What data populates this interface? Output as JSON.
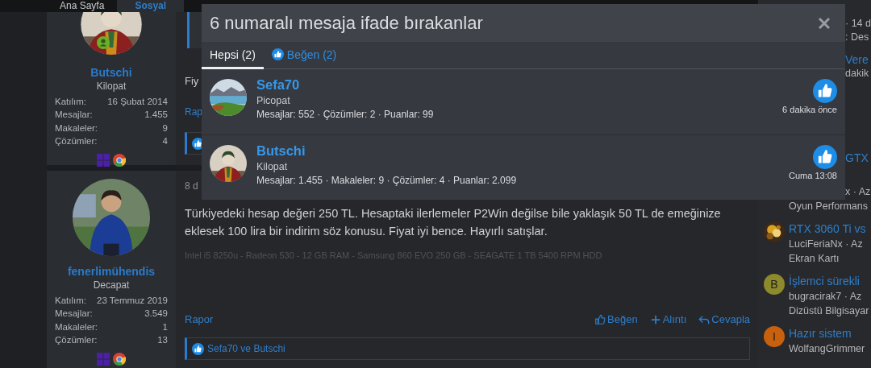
{
  "nav": {
    "items": [
      {
        "label": "Ana Sayfa",
        "selected": false
      },
      {
        "label": "Sosyal",
        "selected": true
      }
    ]
  },
  "posts": [
    {
      "author": {
        "name": "Butschi",
        "title": "Kilopat",
        "online": true,
        "stats": [
          {
            "label": "Katılım:",
            "value": "16 Şubat 2014"
          },
          {
            "label": "Mesajlar:",
            "value": "1.455"
          },
          {
            "label": "Makaleler:",
            "value": "9"
          },
          {
            "label": "Çözümler:",
            "value": "4"
          }
        ]
      },
      "quote": true,
      "body": "Fiy",
      "report": "Rap",
      "reactions": {
        "kind": "like"
      }
    },
    {
      "author": {
        "name": "fenerlimühendis",
        "title": "Decapat",
        "online": false,
        "stats": [
          {
            "label": "Katılım:",
            "value": "23 Temmuz 2019"
          },
          {
            "label": "Mesajlar:",
            "value": "3.549"
          },
          {
            "label": "Makaleler:",
            "value": "1"
          },
          {
            "label": "Çözümler:",
            "value": "13"
          }
        ]
      },
      "date": "8 d",
      "body": "Türkiyedeki hesap değeri 250 TL. Hesaptaki ilerlemeler P2Win değilse bile yaklaşık 50 TL de emeğinize eklesek 100 lira bir indirim söz konusu. Fiyat iyi bence. Hayırlı satışlar.",
      "signature": "Intel i5 8250u - Radeon 530 - 12 GB RAM - Samsung 860 EVO 250 GB - SEAGATE 1 TB 5400 RPM HDD",
      "report": "Rapor",
      "actions": [
        {
          "kind": "like",
          "label": "Beğen"
        },
        {
          "kind": "quote",
          "label": "Alıntı"
        },
        {
          "kind": "reply",
          "label": "Cevapla"
        }
      ],
      "reactions": {
        "kind": "like",
        "text": "Sefa70 ve Butschi"
      }
    }
  ],
  "sidebar": {
    "fragments": [
      {
        "kind": "meta",
        "text": "· 14 d"
      },
      {
        "kind": "meta",
        "text": ": Des"
      },
      {
        "kind": "title",
        "text": "Vere"
      },
      {
        "kind": "meta",
        "text": "dakik"
      }
    ],
    "fragments_2": [
      {
        "kind": "title",
        "text": "GTX"
      },
      {
        "kind": "meta",
        "text": "x · Az"
      }
    ],
    "forum_line": "Oyun Performans",
    "threads": [
      {
        "title": "RTX 3060 Ti vs",
        "meta": "LuciFeriaNx · Az",
        "forum": "Ekran Kartı"
      },
      {
        "avatar": {
          "kind": "letter",
          "letter": "B",
          "color": "#8c8a2c"
        },
        "title": "İşlemci sürekli",
        "meta": "bugracirak7 · Az",
        "forum": "Dizüstü Bilgisayar"
      },
      {
        "avatar": {
          "kind": "letter",
          "letter": "I",
          "color": "#c8600e"
        },
        "title": "Hazır sistem",
        "meta": "WolfangGrimmer"
      }
    ]
  },
  "modal": {
    "title": "6 numaralı mesaja ifade bırakanlar",
    "tabs": [
      {
        "kind": "all",
        "label": "Hepsi (2)",
        "selected": true
      },
      {
        "kind": "like",
        "label": "Beğen (2)",
        "selected": false
      }
    ],
    "rows": [
      {
        "name": "Sefa70",
        "title": "Picopat",
        "stats": "Mesajlar: 552 · Çözümler: 2 · Puanlar: 99",
        "kind": "like",
        "time": "6 dakika önce"
      },
      {
        "name": "Butschi",
        "title": "Kilopat",
        "stats": "Mesajlar: 1.455 · Makaleler: 9 · Çözümler: 4 · Puanlar: 2.099",
        "kind": "like",
        "time": "Cuma 13:08"
      }
    ]
  }
}
